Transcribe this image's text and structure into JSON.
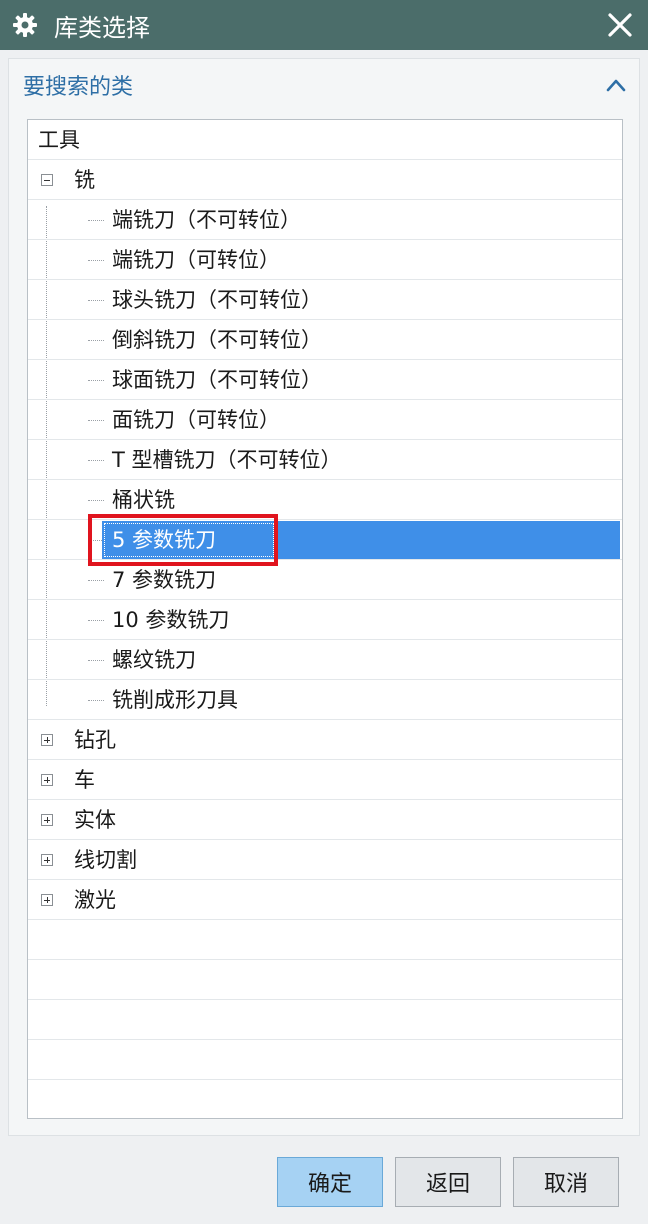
{
  "window": {
    "title": "库类选择",
    "title_icon": "gear-icon",
    "close_icon": "close-icon"
  },
  "section": {
    "title": "要搜索的类",
    "collapse_icon": "chevron-up-icon"
  },
  "tree": {
    "root": "工具",
    "items": [
      {
        "label": "铣",
        "level": 1,
        "expander": "collapse"
      },
      {
        "label": "端铣刀（不可转位）",
        "level": 2
      },
      {
        "label": "端铣刀（可转位）",
        "level": 2
      },
      {
        "label": "球头铣刀（不可转位）",
        "level": 2
      },
      {
        "label": "倒斜铣刀（不可转位）",
        "level": 2
      },
      {
        "label": "球面铣刀（不可转位）",
        "level": 2
      },
      {
        "label": "面铣刀（可转位）",
        "level": 2
      },
      {
        "label": "T 型槽铣刀（不可转位）",
        "level": 2
      },
      {
        "label": "桶状铣",
        "level": 2
      },
      {
        "label": "5 参数铣刀",
        "level": 2,
        "selected": true
      },
      {
        "label": "7 参数铣刀",
        "level": 2
      },
      {
        "label": "10 参数铣刀",
        "level": 2
      },
      {
        "label": "螺纹铣刀",
        "level": 2
      },
      {
        "label": "铣削成形刀具",
        "level": 2
      },
      {
        "label": "钻孔",
        "level": 1,
        "expander": "expand"
      },
      {
        "label": "车",
        "level": 1,
        "expander": "expand"
      },
      {
        "label": "实体",
        "level": 1,
        "expander": "expand"
      },
      {
        "label": "线切割",
        "level": 1,
        "expander": "expand"
      },
      {
        "label": "激光",
        "level": 1,
        "expander": "expand"
      }
    ]
  },
  "buttons": {
    "ok": "确定",
    "back": "返回",
    "cancel": "取消"
  },
  "colors": {
    "titlebar": "#4b6d6a",
    "selection": "#3f8fe8",
    "annotation_box": "#e0141e",
    "primary_button": "#a6d2f3",
    "section_title": "#2e6fa6"
  }
}
